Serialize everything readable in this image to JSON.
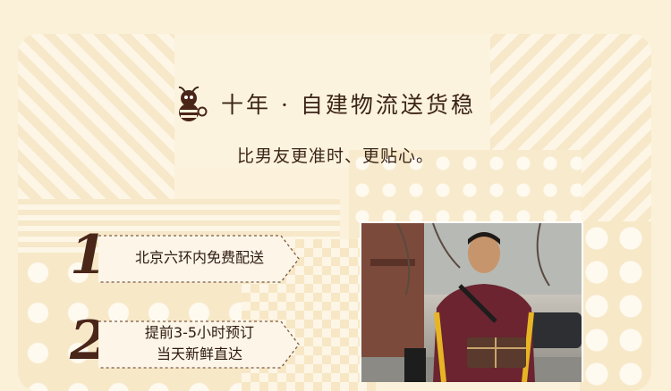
{
  "header": {
    "title": "十年 · 自建物流送货稳",
    "subtitle": "比男友更准时、更贴心。"
  },
  "steps": [
    {
      "number": "1",
      "lines": [
        "北京六环内免费配送"
      ]
    },
    {
      "number": "2",
      "lines": [
        "提前3-5小时预订",
        "当天新鲜直达"
      ]
    }
  ],
  "icons": {
    "mascot": "bee-mascot-icon"
  },
  "colors": {
    "text": "#3b2416",
    "accent": "#4a2618",
    "background": "#fbf1d9"
  }
}
